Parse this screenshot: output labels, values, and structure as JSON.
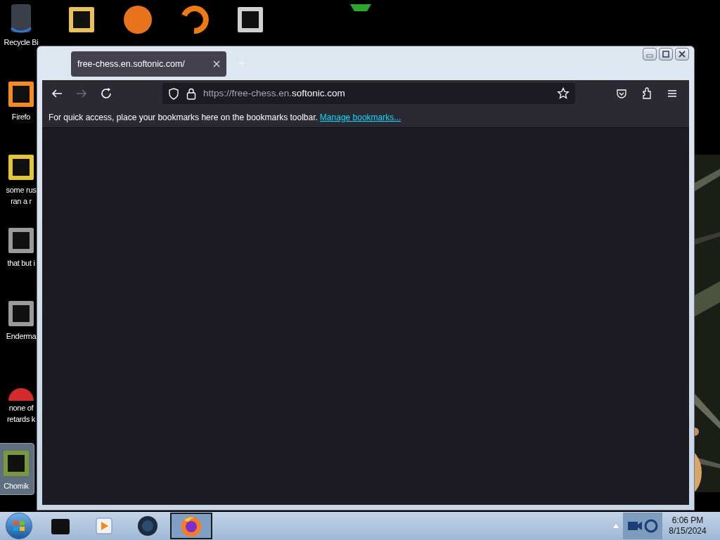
{
  "desktop": {
    "icons": [
      {
        "kind": "bin",
        "lines": [
          "Recycle Bi"
        ],
        "selected": false
      },
      {
        "kind": "folder",
        "selected": false
      },
      {
        "kind": "disc",
        "selected": false
      },
      {
        "kind": "ring",
        "selected": false
      },
      {
        "kind": "doc",
        "selected": false
      },
      {
        "kind": "fire",
        "lines": [
          "Firefo"
        ],
        "selected": false
      },
      {
        "kind": "file",
        "lines": [
          "some rus",
          "ran a r"
        ],
        "selected": false
      },
      {
        "kind": "stack",
        "lines": [
          "that but i"
        ],
        "selected": false
      },
      {
        "kind": "stack",
        "lines": [
          "Enderma"
        ],
        "selected": false
      },
      {
        "kind": "ball",
        "lines": [
          "none of",
          "retards k"
        ],
        "selected": false
      },
      {
        "lines": [
          "Chomik"
        ],
        "selected": true
      }
    ]
  },
  "browser": {
    "tabs": [
      {
        "title": "free-chess.en.softonic.com/",
        "selected": true
      }
    ],
    "nav": {
      "back_disabled": false,
      "forward_disabled": true
    },
    "url": {
      "prefix": "https://free-chess.en.",
      "domain": "softonic.com"
    },
    "bookmarks_bar": {
      "message": "For quick access, place your bookmarks here on the bookmarks toolbar.",
      "link": "Manage bookmarks..."
    }
  },
  "taskbar": {
    "apps": [
      {
        "kind": "box",
        "selected": false
      },
      {
        "kind": "media",
        "selected": false
      },
      {
        "kind": "globe",
        "selected": false
      },
      {
        "kind": "firefox",
        "selected": true
      }
    ],
    "clock": {
      "time": "6:06 PM",
      "date": "8/15/2024"
    }
  }
}
